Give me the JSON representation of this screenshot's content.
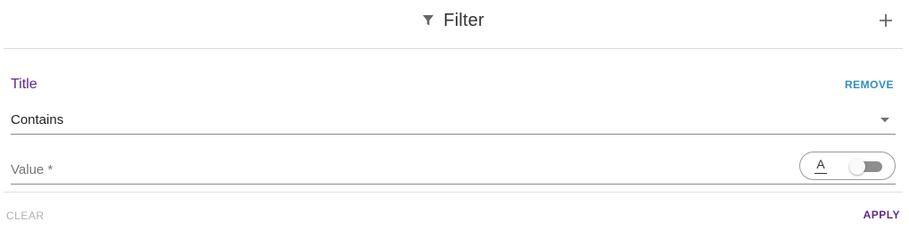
{
  "header": {
    "title": "Filter",
    "icon": "filter-icon",
    "add_icon": "plus-icon"
  },
  "field": {
    "label": "Title",
    "remove_label": "REMOVE"
  },
  "operator": {
    "value": "Contains"
  },
  "value_input": {
    "placeholder": "Value *",
    "value": "",
    "case_icon_text": "A",
    "case_sensitive": false
  },
  "footer": {
    "clear_label": "CLEAR",
    "apply_label": "APPLY"
  },
  "colors": {
    "label": "#5b2a86",
    "remove": "#2f8fc6",
    "apply": "#5b2a86",
    "clear_disabled": "#b0b0b0"
  }
}
